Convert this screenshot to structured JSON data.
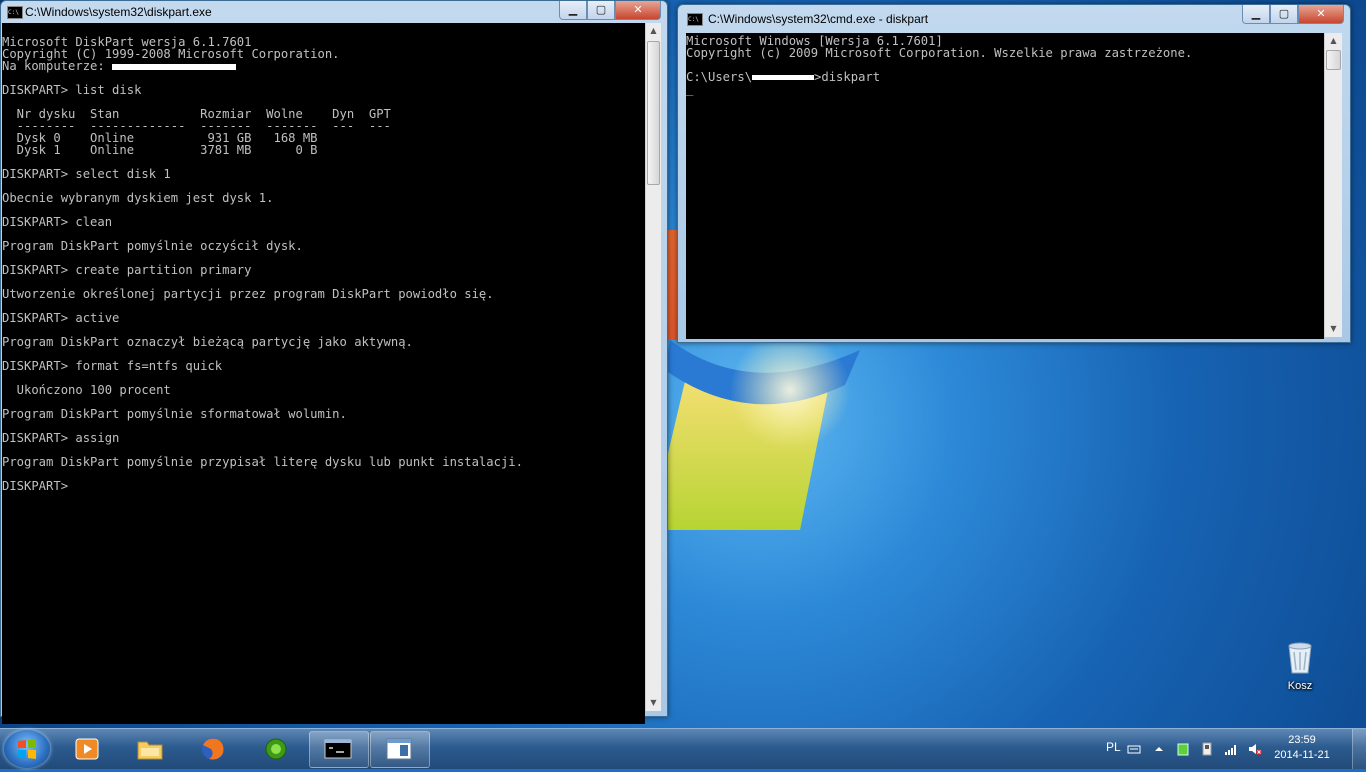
{
  "window_left": {
    "title": "C:\\Windows\\system32\\diskpart.exe",
    "line1": "Microsoft DiskPart wersja 6.1.7601",
    "line2": "Copyright (C) 1999-2008 Microsoft Corporation.",
    "line3": "Na komputerze: ",
    "cmd_list": "DISKPART> list disk",
    "table_header": "  Nr dysku  Stan           Rozmiar  Wolne    Dyn  GPT",
    "table_sep": "  --------  -------------  -------  -------  ---  ---",
    "disk0": "  Dysk 0    Online          931 GB   168 MB",
    "disk1": "  Dysk 1    Online         3781 MB      0 B",
    "cmd_select": "DISKPART> select disk 1",
    "out_select": "Obecnie wybranym dyskiem jest dysk 1.",
    "cmd_clean": "DISKPART> clean",
    "out_clean": "Program DiskPart pomyślnie oczyścił dysk.",
    "cmd_create": "DISKPART> create partition primary",
    "out_create": "Utworzenie określonej partycji przez program DiskPart powiodło się.",
    "cmd_active": "DISKPART> active",
    "out_active": "Program DiskPart oznaczył bieżącą partycję jako aktywną.",
    "cmd_format": "DISKPART> format fs=ntfs quick",
    "out_format1": "  Ukończono 100 procent",
    "out_format2": "Program DiskPart pomyślnie sformatował wolumin.",
    "cmd_assign": "DISKPART> assign",
    "out_assign": "Program DiskPart pomyślnie przypisał literę dysku lub punkt instalacji.",
    "prompt": "DISKPART> "
  },
  "window_right": {
    "title": "C:\\Windows\\system32\\cmd.exe - diskpart",
    "line1": "Microsoft Windows [Wersja 6.1.7601]",
    "line2": "Copyright (c) 2009 Microsoft Corporation. Wszelkie prawa zastrzeżone.",
    "prompt_prefix": "C:\\Users\\",
    "prompt_suffix": ">diskpart",
    "cursor": "_"
  },
  "desktop": {
    "recycle_bin_label": "Kosz"
  },
  "taskbar": {
    "language": "PL",
    "time": "23:59",
    "date": "2014-11-21",
    "buttons": [
      "start",
      "media-player",
      "explorer",
      "firefox",
      "app-green",
      "cmd",
      "app-window"
    ]
  }
}
